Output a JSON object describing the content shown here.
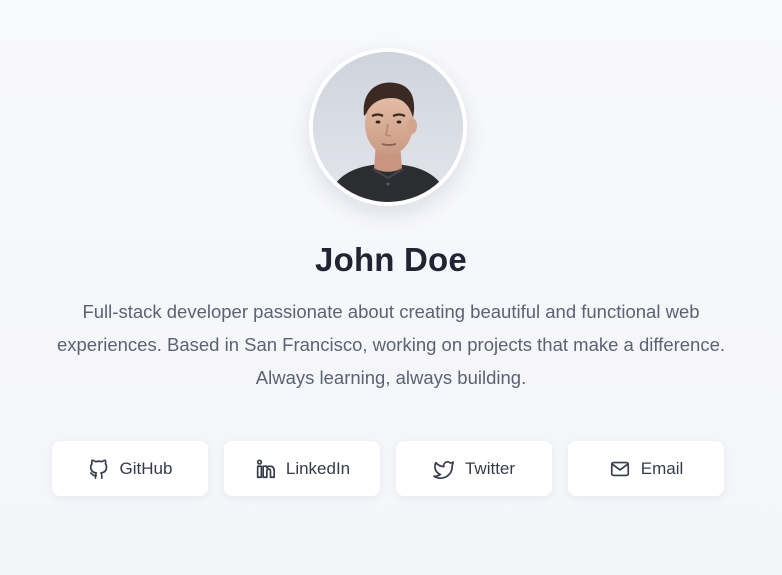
{
  "profile": {
    "name": "John Doe",
    "bio": "Full-stack developer passionate about creating beautiful and functional web experiences. Based in San Francisco, working on projects that make a difference. Always learning, always building."
  },
  "links": [
    {
      "label": "GitHub",
      "icon": "github-icon"
    },
    {
      "label": "LinkedIn",
      "icon": "linkedin-icon"
    },
    {
      "label": "Twitter",
      "icon": "twitter-icon"
    },
    {
      "label": "Email",
      "icon": "mail-icon"
    }
  ],
  "colors": {
    "background": "#f6f7fb",
    "card": "#ffffff",
    "text_primary": "#202433",
    "text_secondary": "#5b6273"
  }
}
